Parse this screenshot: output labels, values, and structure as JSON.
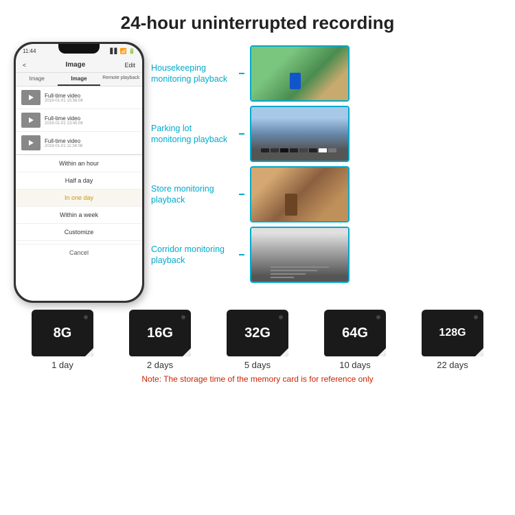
{
  "title": "24-hour uninterrupted recording",
  "phone": {
    "status_time": "11:44",
    "nav_back": "<",
    "nav_title": "Image",
    "nav_edit": "Edit",
    "tabs": [
      "Image",
      "Image",
      "Remote playback"
    ],
    "list_items": [
      {
        "title": "Full-time video",
        "date": "2019-01-01 15:56:08"
      },
      {
        "title": "Full-time video",
        "date": "2019-01-01 13:45:08"
      },
      {
        "title": "Full-time video",
        "date": "2019-01-01 11:34:08"
      }
    ],
    "dropdown_items": [
      "Within an hour",
      "Half a day",
      "In one day",
      "Within a week",
      "Customize"
    ],
    "cancel_label": "Cancel"
  },
  "monitoring": [
    {
      "label": "Housekeeping\nmonitoring playback",
      "img_type": "housekeeping"
    },
    {
      "label": "Parking lot\nmonitoring playback",
      "img_type": "parking"
    },
    {
      "label": "Store monitoring\nplayback",
      "img_type": "store"
    },
    {
      "label": "Corridor monitoring\nplayback",
      "img_type": "corridor"
    }
  ],
  "storage_cards": [
    {
      "size": "8G",
      "days": "1 day"
    },
    {
      "size": "16G",
      "days": "2 days"
    },
    {
      "size": "32G",
      "days": "5 days"
    },
    {
      "size": "64G",
      "days": "10 days"
    },
    {
      "size": "128G",
      "days": "22 days"
    }
  ],
  "note": "Note: The storage time of the memory card is for reference only"
}
